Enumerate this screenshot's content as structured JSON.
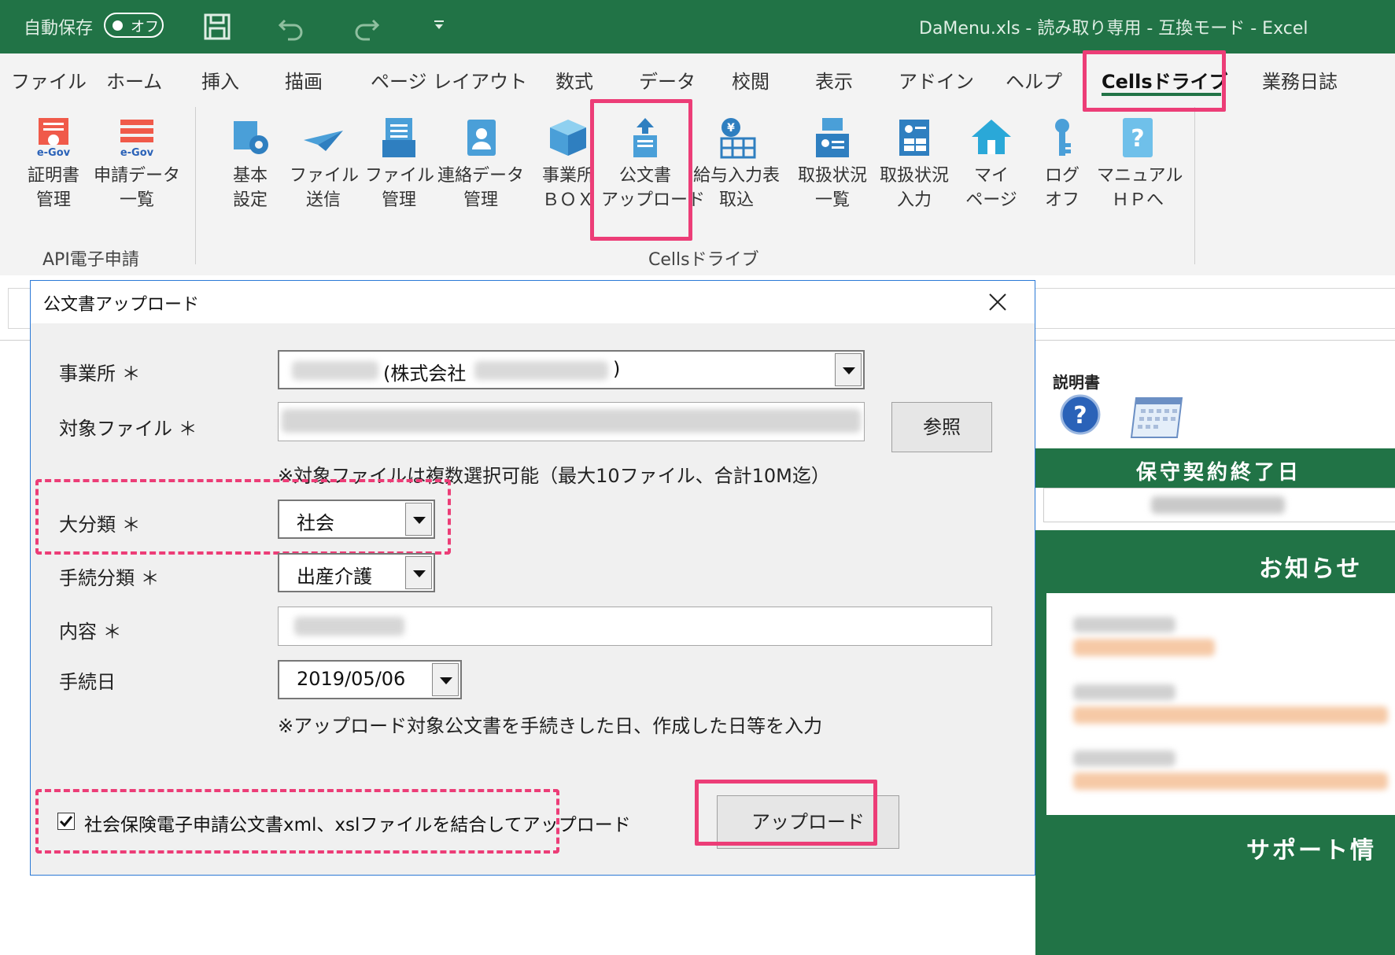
{
  "titlebar": {
    "autosave_label": "自動保存",
    "autosave_state": "オフ",
    "document_title": "DaMenu.xls - 読み取り専用 - 互換モード - Excel"
  },
  "ribbon_tabs": [
    "ファイル",
    "ホーム",
    "挿入",
    "描画",
    "ページ レイアウト",
    "数式",
    "データ",
    "校閲",
    "表示",
    "アドイン",
    "ヘルプ",
    "Cellsドライブ",
    "業務日誌"
  ],
  "ribbon_groups": {
    "api": {
      "name": "API電子申請",
      "buttons": [
        {
          "l1": "証明書",
          "l2": "管理",
          "icon": "certificate-icon"
        },
        {
          "l1": "申請データ",
          "l2": "一覧",
          "icon": "application-list-icon"
        }
      ]
    },
    "cells": {
      "name": "Cellsドライブ",
      "buttons": [
        {
          "l1": "基本",
          "l2": "設定",
          "icon": "settings-gear-icon"
        },
        {
          "l1": "ファイル",
          "l2": "送信",
          "icon": "paper-plane-icon"
        },
        {
          "l1": "ファイル",
          "l2": "管理",
          "icon": "file-stack-icon"
        },
        {
          "l1": "連絡データ",
          "l2": "管理",
          "icon": "contact-data-icon"
        },
        {
          "l1": "事業所",
          "l2": "ＢＯＸ",
          "icon": "box-icon"
        },
        {
          "l1": "公文書",
          "l2": "アップロード",
          "icon": "document-upload-icon"
        },
        {
          "l1": "給与入力表",
          "l2": "取込",
          "icon": "yen-table-icon"
        },
        {
          "l1": "取扱状況",
          "l2": "一覧",
          "icon": "status-list-icon"
        },
        {
          "l1": "取扱状況",
          "l2": "入力",
          "icon": "status-input-icon"
        },
        {
          "l1": "マイ",
          "l2": "ページ",
          "icon": "home-icon"
        },
        {
          "l1": "ログ",
          "l2": "オフ",
          "icon": "key-icon"
        },
        {
          "l1": "マニュアル",
          "l2": "ＨＰへ",
          "icon": "manual-help-icon"
        }
      ]
    }
  },
  "dialog": {
    "title": "公文書アップロード",
    "office_label": "事業所 ＊",
    "office_value_visible": "(株式会社",
    "office_value_close": ")",
    "target_file_label": "対象ファイル ＊",
    "browse_button": "参照",
    "file_note": "※対象ファイルは複数選択可能（最大10ファイル、合計10M迄）",
    "major_category_label": "大分類 ＊",
    "major_category_value": "社会",
    "procedure_category_label": "手続分類 ＊",
    "procedure_category_value": "出産介護",
    "content_label": "内容 ＊",
    "procedure_date_label": "手続日",
    "procedure_date_value": "2019/05/06",
    "date_note": "※アップロード対象公文書を手続きした日、作成した日等を入力",
    "merge_checkbox_label": "社会保険電子申請公文書xml、xslファイルを結合してアップロード",
    "upload_button": "アップロード"
  },
  "side_panel": {
    "manual_label": "説明書",
    "maintenance_title": "保守契約終了日",
    "notice_title": "お知らせ",
    "support_title": "サポート情"
  },
  "colors": {
    "excel_green": "#217346",
    "highlight_pink": "#ec3d77",
    "dialog_border": "#2b79d6"
  }
}
